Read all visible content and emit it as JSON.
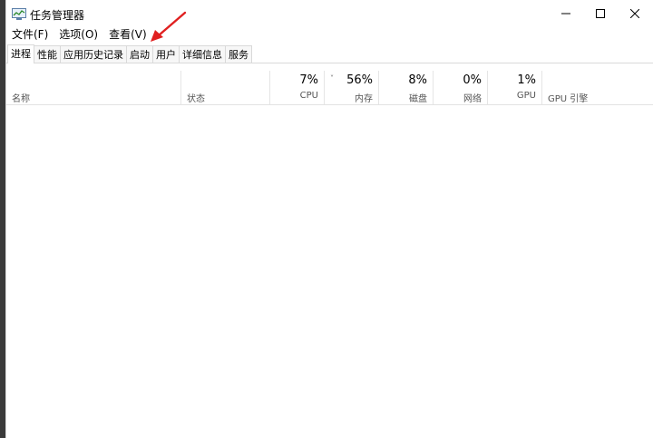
{
  "window": {
    "title": "任务管理器"
  },
  "menu": {
    "items": [
      {
        "label": "文件(F)"
      },
      {
        "label": "选项(O)"
      },
      {
        "label": "查看(V)"
      }
    ]
  },
  "tabs": [
    {
      "label": "进程",
      "active": true
    },
    {
      "label": "性能"
    },
    {
      "label": "应用历史记录"
    },
    {
      "label": "启动"
    },
    {
      "label": "用户"
    },
    {
      "label": "详细信息"
    },
    {
      "label": "服务"
    }
  ],
  "columns": {
    "name": {
      "label": "名称"
    },
    "status": {
      "label": "状态"
    },
    "cpu": {
      "value": "7%",
      "label": "CPU"
    },
    "memory": {
      "value": "56%",
      "label": "内存",
      "sort_glyph": "˅"
    },
    "disk": {
      "value": "8%",
      "label": "磁盘"
    },
    "network": {
      "value": "0%",
      "label": "网络"
    },
    "gpu": {
      "value": "1%",
      "label": "GPU"
    },
    "gpu_engine": {
      "label": "GPU 引擎"
    }
  },
  "icons": {
    "app": "task-manager-icon",
    "minimize": "minimize-icon",
    "maximize": "maximize-icon",
    "close": "close-icon",
    "annotation": "red-arrow-annotation"
  },
  "colors": {
    "annotation": "#e02020",
    "background": "#ffffff",
    "desktop": "#3a3a3a"
  }
}
